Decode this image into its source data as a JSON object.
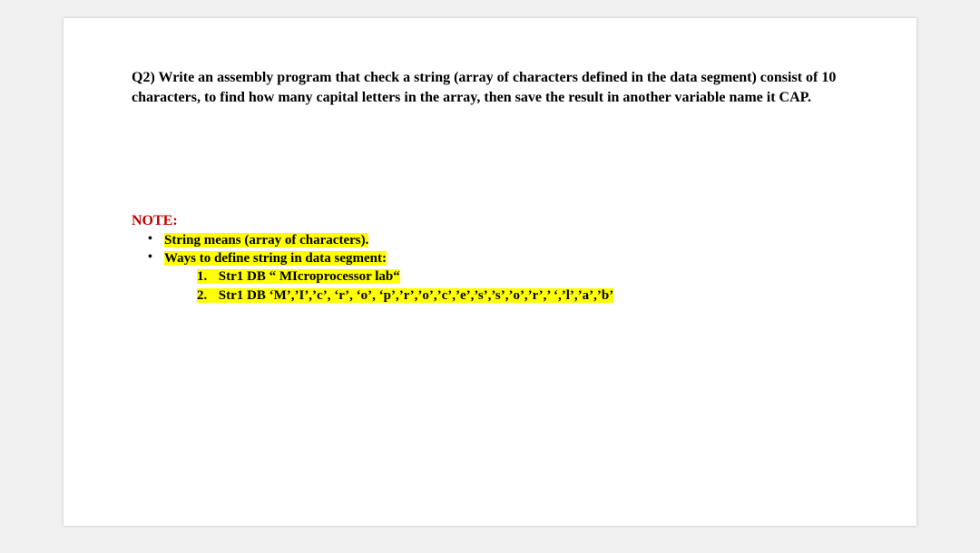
{
  "question": "Q2) Write an assembly program that check a string (array of characters defined in the data segment) consist of 10 characters, to find how many capital letters in the array, then save the result in another variable name it CAP.",
  "note": {
    "title": "NOTE:",
    "bullets": [
      "String means (array of characters).",
      "Ways to define string in data segment:"
    ],
    "numbered": [
      {
        "marker": "1.",
        "text": "Str1 DB “ MIcroprocessor lab“"
      },
      {
        "marker": "2.",
        "text": "Str1 DB ‘M’,’I’,’c’, ‘r’, ‘o’, ‘p’,’r’,’o’,’c’,’e’,’s’,’s’,’o’,’r’,’ ‘,’l’,’a’,’b’"
      }
    ]
  }
}
